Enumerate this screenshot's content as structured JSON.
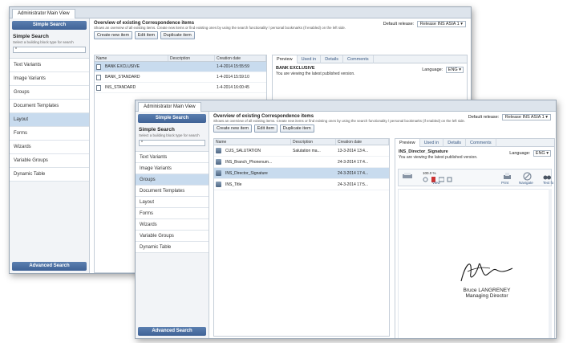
{
  "back_window": {
    "tab_label": "Administrator Main View",
    "sidebar": {
      "header_button": "Simple Search",
      "title": "Simple Search",
      "description": "Select a building block type for search",
      "search_value": "*",
      "items": [
        "Text Variants",
        "Image Variants",
        "Groups",
        "Document Templates",
        "Layout",
        "Forms",
        "Wizards",
        "Variable Groups",
        "Dynamic Table"
      ],
      "active_item": "Layout",
      "footer_button": "Advanced Search"
    },
    "main": {
      "title": "Overview of existing Correspondence items",
      "description": "Shows an overview of all existing items. Create new items or find existing ones by using the search functionality / personal bookmarks (if enabled) on the left side.",
      "release_label": "Default release:",
      "release_value": "Release INS ASIA 1",
      "buttons": [
        "Create new item",
        "Edit item",
        "Duplicate item"
      ],
      "columns": [
        "Name",
        "Description",
        "Creation date"
      ],
      "rows": [
        {
          "name": "BANK EXCLUSIVE",
          "description": "",
          "date": "1-4-2014 15:55:59"
        },
        {
          "name": "BANK_STANDARD",
          "description": "",
          "date": "1-4-2014 15:59:10"
        },
        {
          "name": "INS_STANDARD",
          "description": "",
          "date": "1-4-2014 16:00:45"
        }
      ],
      "preview_tabs": [
        "Preview",
        "Used in",
        "Details",
        "Comments"
      ],
      "preview_item": "BANK EXCLUSIVE",
      "language_label": "Language:",
      "language_value": "ENG",
      "preview_note": "You are viewing the latest published version."
    }
  },
  "front_window": {
    "tab_label": "Administrator Main View",
    "sidebar": {
      "header_button": "Simple Search",
      "title": "Simple Search",
      "description": "Select a building block type for search",
      "search_value": "*",
      "items": [
        "Text Variants",
        "Image Variants",
        "Groups",
        "Document Templates",
        "Layout",
        "Forms",
        "Wizards",
        "Variable Groups",
        "Dynamic Table"
      ],
      "active_item": "Groups",
      "footer_button": "Advanced Search"
    },
    "main": {
      "title": "Overview of existing Correspondence items",
      "description": "Shows an overview of all existing items. Create new items or find existing ones by using the search functionality / personal bookmarks (if enabled) on the left side.",
      "release_label": "Default release:",
      "release_value": "Release INS ASIA 1",
      "buttons": [
        "Create new item",
        "Edit item",
        "Duplicate item"
      ],
      "columns": [
        "Name",
        "Description",
        "Creation date"
      ],
      "rows": [
        {
          "name": "CUS_SALUTATION",
          "description": "Salutation ma...",
          "date": "13-3-2014 13:4..."
        },
        {
          "name": "INS_Branch_Phonenum...",
          "description": "",
          "date": "24-3-2014 17:4..."
        },
        {
          "name": "INS_Director_Signature",
          "description": "",
          "date": "24-3-2014 17:4..."
        },
        {
          "name": "INS_Title",
          "description": "",
          "date": "24-3-2014 17:5..."
        }
      ],
      "selected_row": 2,
      "preview_tabs": [
        "Preview",
        "Used in",
        "Details",
        "Comments"
      ],
      "preview_item": "INS_Director_Signature",
      "language_label": "Language:",
      "language_value": "ENG",
      "preview_note": "You are viewing the latest published version.",
      "toolbar": {
        "zoom_value": "100.0 %",
        "labels": [
          "View",
          "Print",
          "Navigate",
          "Text fo"
        ]
      },
      "signature": {
        "name": "Bruce LANGRENEY",
        "title": "Managing Director"
      }
    }
  },
  "colors": {
    "sidebar_button": "#3f6296",
    "selected_row": "#c8dbee",
    "border": "#9aa7b5"
  }
}
